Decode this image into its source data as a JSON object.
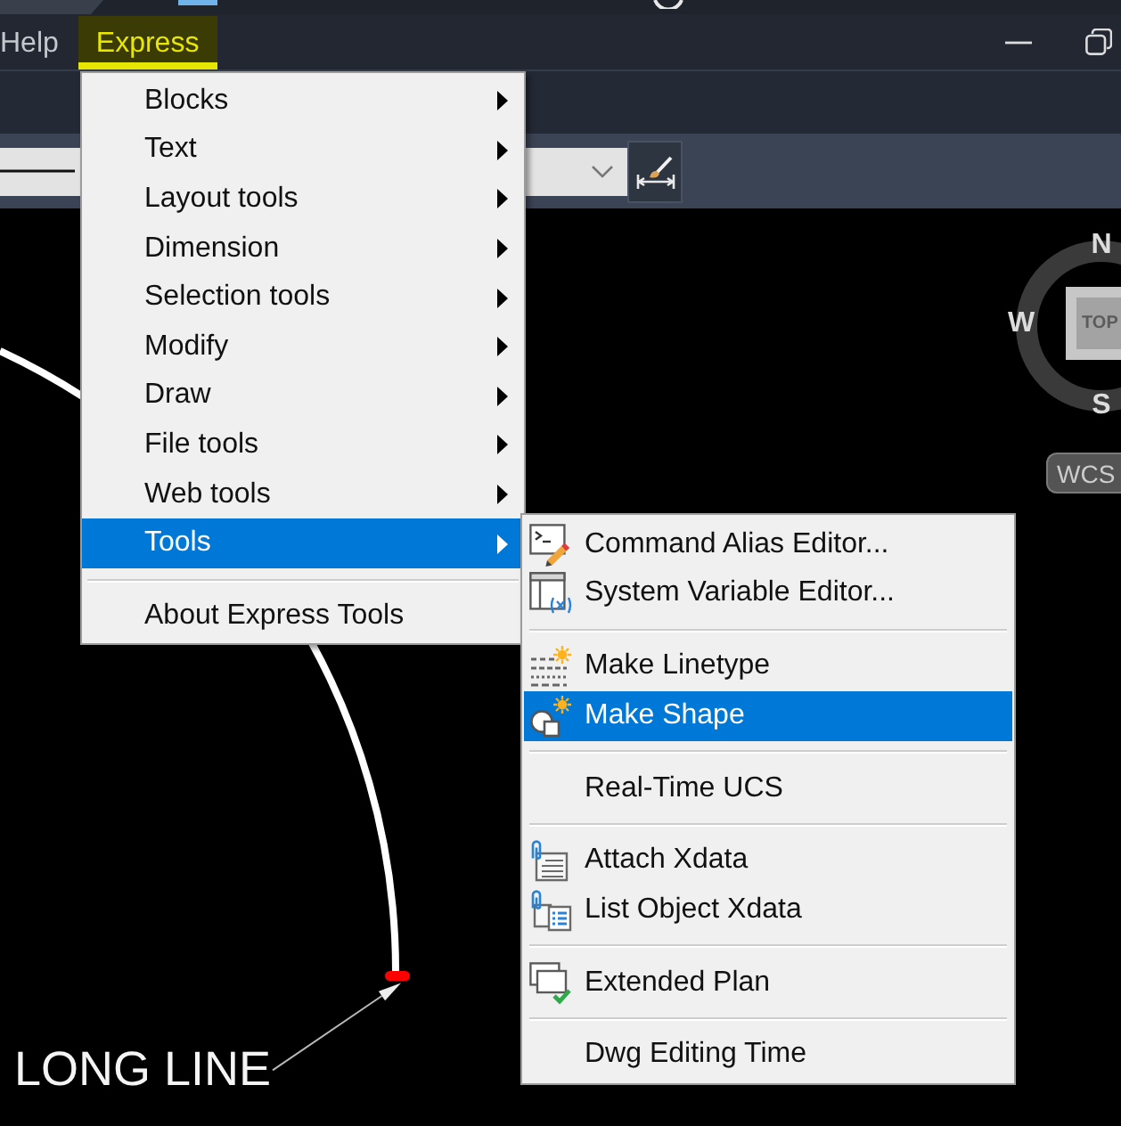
{
  "menu_bar": {
    "items": [
      {
        "label": "Help",
        "selected": false
      },
      {
        "label": "Express",
        "selected": true
      }
    ]
  },
  "express_menu": {
    "items": [
      {
        "kind": "item",
        "label": "Blocks",
        "submenu": true,
        "selected": false
      },
      {
        "kind": "item",
        "label": "Text",
        "submenu": true,
        "selected": false
      },
      {
        "kind": "item",
        "label": "Layout tools",
        "submenu": true,
        "selected": false
      },
      {
        "kind": "item",
        "label": "Dimension",
        "submenu": true,
        "selected": false
      },
      {
        "kind": "item",
        "label": "Selection tools",
        "submenu": true,
        "selected": false
      },
      {
        "kind": "item",
        "label": "Modify",
        "submenu": true,
        "selected": false
      },
      {
        "kind": "item",
        "label": "Draw",
        "submenu": true,
        "selected": false
      },
      {
        "kind": "item",
        "label": "File tools",
        "submenu": true,
        "selected": false
      },
      {
        "kind": "item",
        "label": "Web tools",
        "submenu": true,
        "selected": false
      },
      {
        "kind": "item",
        "label": "Tools",
        "submenu": true,
        "selected": true
      },
      {
        "kind": "separator"
      },
      {
        "kind": "item",
        "label": "About Express Tools",
        "submenu": false,
        "selected": false
      }
    ]
  },
  "tools_submenu": {
    "items": [
      {
        "kind": "item",
        "label": "Command Alias Editor...",
        "selected": false
      },
      {
        "kind": "item",
        "label": "System Variable Editor...",
        "selected": false
      },
      {
        "kind": "separator"
      },
      {
        "kind": "item",
        "label": "Make Linetype",
        "selected": false
      },
      {
        "kind": "item",
        "label": "Make Shape",
        "selected": true
      },
      {
        "kind": "separator"
      },
      {
        "kind": "item",
        "label": "Real-Time UCS",
        "selected": false
      },
      {
        "kind": "separator"
      },
      {
        "kind": "item",
        "label": "Attach Xdata",
        "selected": false
      },
      {
        "kind": "item",
        "label": "List Object Xdata",
        "selected": false
      },
      {
        "kind": "separator"
      },
      {
        "kind": "item",
        "label": "Extended Plan",
        "selected": false
      },
      {
        "kind": "separator"
      },
      {
        "kind": "item",
        "label": "Dwg Editing Time",
        "selected": false
      }
    ]
  },
  "drawing": {
    "annotation": "LONG LINE"
  },
  "view_cube": {
    "north": "N",
    "west": "W",
    "south": "S",
    "face": "TOP"
  },
  "coordinate_system": {
    "label": "WCS"
  }
}
